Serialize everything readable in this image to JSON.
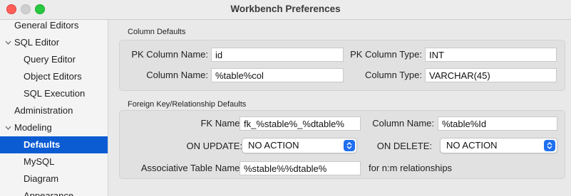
{
  "window": {
    "title": "Workbench Preferences"
  },
  "sidebar": {
    "items": [
      {
        "label": "General Editors"
      },
      {
        "label": "SQL Editor"
      },
      {
        "label": "Query Editor"
      },
      {
        "label": "Object Editors"
      },
      {
        "label": "SQL Execution"
      },
      {
        "label": "Administration"
      },
      {
        "label": "Modeling"
      },
      {
        "label": "Defaults",
        "selected": true
      },
      {
        "label": "MySQL"
      },
      {
        "label": "Diagram"
      },
      {
        "label": "Appearance"
      }
    ]
  },
  "column_defaults": {
    "section_title": "Column Defaults",
    "pk_column_name_label": "PK Column Name:",
    "pk_column_name_value": "id",
    "pk_column_type_label": "PK Column Type:",
    "pk_column_type_value": "INT",
    "column_name_label": "Column Name:",
    "column_name_value": "%table%col",
    "column_type_label": "Column Type:",
    "column_type_value": "VARCHAR(45)"
  },
  "fk_defaults": {
    "section_title": "Foreign Key/Relationship Defaults",
    "fk_name_label": "FK Name:",
    "fk_name_value": "fk_%stable%_%dtable%",
    "column_name_label": "Column Name:",
    "column_name_value": "%table%Id",
    "on_update_label": "ON UPDATE:",
    "on_update_value": "NO ACTION",
    "on_delete_label": "ON DELETE:",
    "on_delete_value": "NO ACTION",
    "assoc_table_label": "Associative Table Name:",
    "assoc_table_value": "%stable%%dtable%",
    "assoc_note": "for n:m relationships"
  }
}
